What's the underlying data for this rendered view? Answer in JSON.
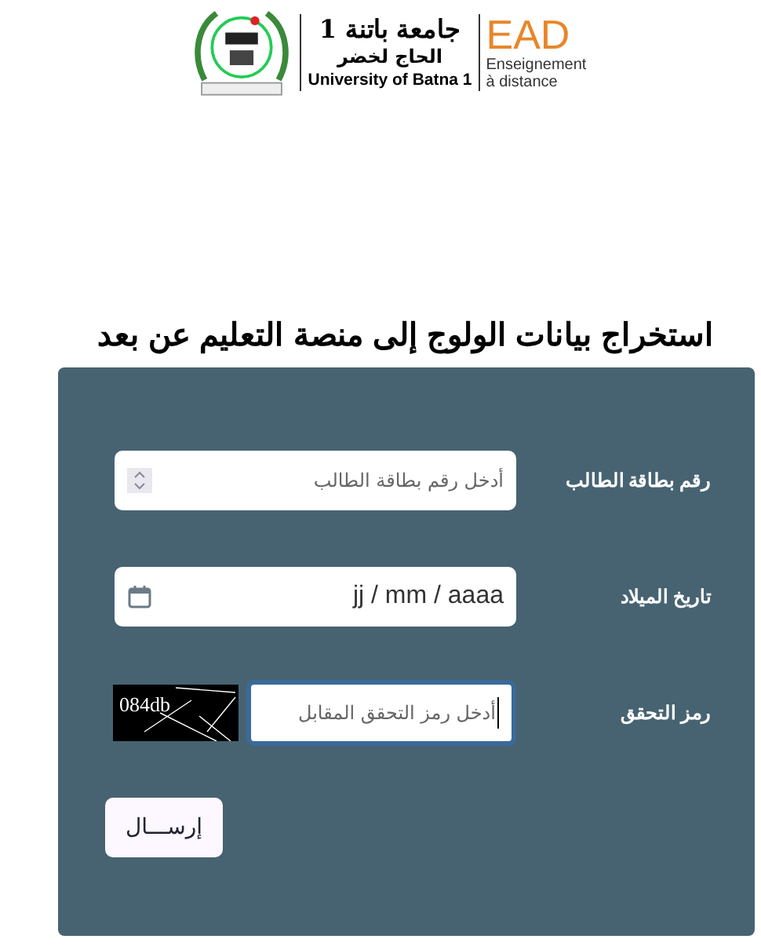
{
  "logo": {
    "arabic_name": "جامعة باتنة 1",
    "arabic_subtitle": "الحاج لخضر",
    "english_name": "University of Batna 1",
    "ead": "EAD",
    "ead_line_1": "Enseignement",
    "ead_line_2": "à distance"
  },
  "title": "استخراج بيانات الولوج إلى منصة التعليم عن بعد",
  "fields": [
    {
      "kind": "number",
      "label": "رقم بطاقة الطالب",
      "placeholder": "أدخل رقم بطاقة الطالب",
      "focused": false
    },
    {
      "kind": "date",
      "label": "تاريخ الميلاد",
      "value": "jj / mm / aaaa",
      "focused": false
    },
    {
      "kind": "captcha",
      "label": "رمز التحقق",
      "placeholder": "أدخل رمز التحقق المقابل",
      "captcha": "084db",
      "focused": true
    }
  ],
  "submit": "إرســـال"
}
